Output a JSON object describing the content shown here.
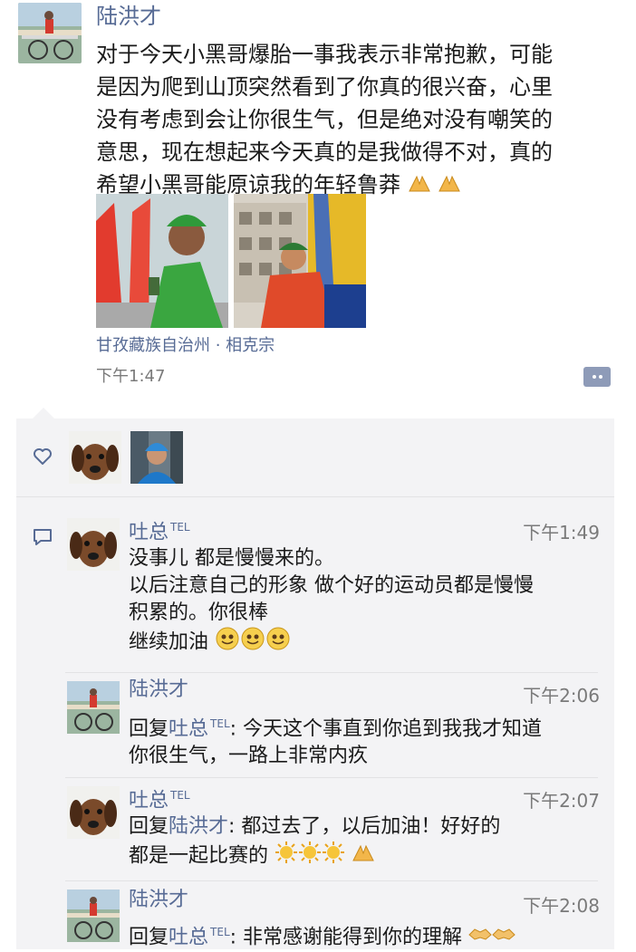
{
  "post": {
    "author": "陆洪才",
    "text_lines": [
      "对于今天小黑哥爆胎一事我表示非常抱歉，可能",
      "是因为爬到山顶突然看到了你真的很兴奋，心里",
      "没有考虑到会让你很生气，但是绝对没有嘲笑的",
      "意思，现在想起来今天真的是我做得不对，真的",
      "希望小黑哥能原谅我的年轻鲁莽"
    ],
    "location": "甘孜藏族自治州 · 相克宗",
    "time": "下午1:47"
  },
  "comments": [
    {
      "author": "吐总",
      "tel": "TEL",
      "time": "下午1:49",
      "lines": [
        "没事儿  都是慢慢来的。",
        "以后注意自己的形象  做个好的运动员都是慢慢",
        "积累的。你很棒",
        "继续加油"
      ]
    },
    {
      "author": "陆洪才",
      "time": "下午2:06",
      "reply_prefix": "回复",
      "reply_to": "吐总",
      "reply_tel": "TEL",
      "lines": [
        ": 今天这个事直到你追到我我才知道",
        "你很生气，一路上非常内疚"
      ]
    },
    {
      "author": "吐总",
      "tel": "TEL",
      "time": "下午2:07",
      "reply_prefix": "回复",
      "reply_to": "陆洪才",
      "lines": [
        ": 都过去了，以后加油！好好的",
        "都是一起比赛的"
      ]
    },
    {
      "author": "陆洪才",
      "time": "下午2:08",
      "reply_prefix": "回复",
      "reply_to": "吐总",
      "reply_tel": "TEL",
      "lines": [
        ": 非常感谢能得到你的理解"
      ]
    }
  ],
  "colors": {
    "link_blue": "#576b95",
    "panel_bg": "#f3f3f5",
    "time_gray": "#7a7a7a"
  }
}
